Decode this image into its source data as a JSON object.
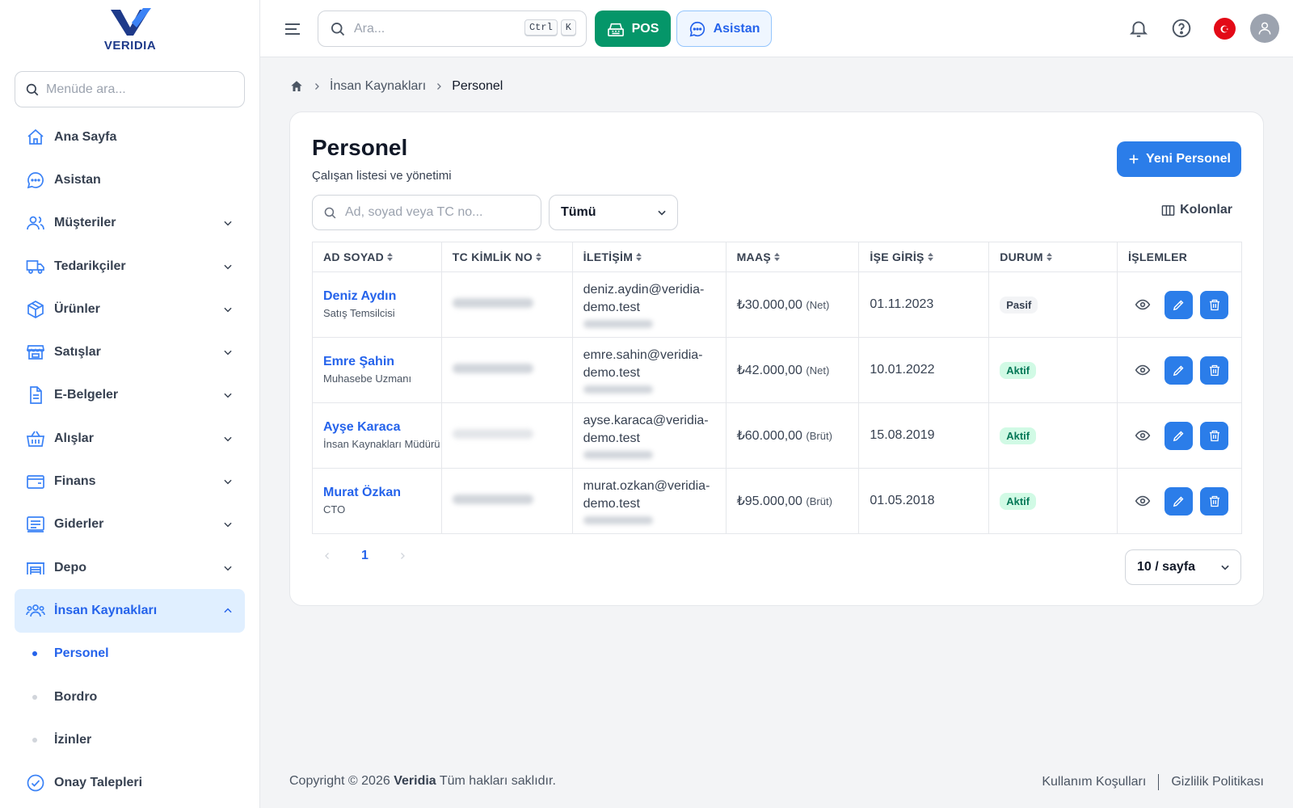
{
  "brand": {
    "logo_text": "VERIDIA"
  },
  "sidebar": {
    "search_placeholder": "Menüde ara...",
    "items": [
      {
        "label": "Ana Sayfa",
        "icon": "home-icon"
      },
      {
        "label": "Asistan",
        "icon": "chat-icon"
      },
      {
        "label": "Müşteriler",
        "icon": "users-icon"
      },
      {
        "label": "Tedarikçiler",
        "icon": "truck-icon"
      },
      {
        "label": "Ürünler",
        "icon": "box-icon"
      },
      {
        "label": "Satışlar",
        "icon": "store-icon"
      },
      {
        "label": "E-Belgeler",
        "icon": "document-icon"
      },
      {
        "label": "Alışlar",
        "icon": "basket-icon"
      },
      {
        "label": "Finans",
        "icon": "wallet-icon"
      },
      {
        "label": "Giderler",
        "icon": "receipt-icon"
      },
      {
        "label": "Depo",
        "icon": "warehouse-icon"
      },
      {
        "label": "İnsan Kaynakları",
        "icon": "people-icon"
      },
      {
        "label": "Onay Talepleri",
        "icon": "check-circle-icon"
      }
    ],
    "hr_children": [
      {
        "label": "Personel"
      },
      {
        "label": "Bordro"
      },
      {
        "label": "İzinler"
      }
    ]
  },
  "topbar": {
    "search_placeholder": "Ara...",
    "shortcut_ctrl": "Ctrl",
    "shortcut_key": "K",
    "pos_label": "POS",
    "assistant_label": "Asistan"
  },
  "breadcrumb": {
    "parent": "İnsan Kaynakları",
    "current": "Personel"
  },
  "page": {
    "title": "Personel",
    "subtitle": "Çalışan listesi ve yönetimi",
    "new_button": "Yeni Personel",
    "filter_placeholder": "Ad, soyad veya TC no...",
    "status_filter": "Tümü",
    "columns_button": "Kolonlar"
  },
  "table": {
    "headers": {
      "name": "AD SOYAD",
      "tc": "TC KİMLİK NO",
      "contact": "İLETİŞİM",
      "salary": "MAAŞ",
      "start": "İŞE GİRİŞ",
      "status": "DURUM",
      "actions": "İŞLEMLER"
    },
    "rows": [
      {
        "name": "Deniz Aydın",
        "role": "Satış Temsilcisi",
        "email_1": "deniz.aydin@veridia-",
        "email_2": "demo.test",
        "salary": "₺30.000,00",
        "salary_type": "(Net)",
        "start": "01.11.2023",
        "status": "Pasif"
      },
      {
        "name": "Emre Şahin",
        "role": "Muhasebe Uzmanı",
        "email_1": "emre.sahin@veridia-",
        "email_2": "demo.test",
        "salary": "₺42.000,00",
        "salary_type": "(Net)",
        "start": "10.01.2022",
        "status": "Aktif"
      },
      {
        "name": "Ayşe Karaca",
        "role": "İnsan Kaynakları Müdürü",
        "email_1": "ayse.karaca@veridia-",
        "email_2": "demo.test",
        "salary": "₺60.000,00",
        "salary_type": "(Brüt)",
        "start": "15.08.2019",
        "status": "Aktif"
      },
      {
        "name": "Murat Özkan",
        "role": "CTO",
        "email_1": "murat.ozkan@veridia-",
        "email_2": "demo.test",
        "salary": "₺95.000,00",
        "salary_type": "(Brüt)",
        "start": "01.05.2018",
        "status": "Aktif"
      }
    ]
  },
  "pagination": {
    "current_page": "1",
    "per_page": "10 / sayfa"
  },
  "footer": {
    "copyright_prefix": "Copyright © 2026",
    "brand": "Veridia",
    "copyright_suffix": "Tüm hakları saklıdır.",
    "terms": "Kullanım Koşulları",
    "privacy": "Gizlilik Politikası"
  },
  "colors": {
    "primary": "#2b7de9",
    "pos_green": "#059669",
    "active_bg": "#e0efff",
    "badge_active_bg": "#d1fae5",
    "badge_active_text": "#047857"
  }
}
